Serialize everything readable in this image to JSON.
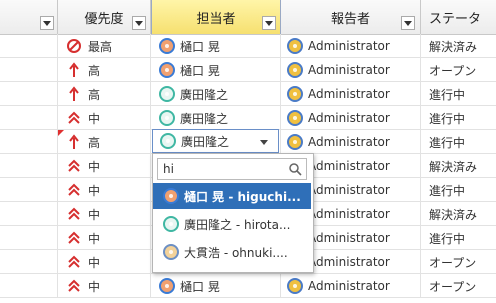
{
  "headers": {
    "priority": "優先度",
    "assignee": "担当者",
    "reporter": "報告者",
    "status": "ステータ"
  },
  "colors": {
    "accent": "#2f6fb8",
    "selectedHeader": "#f6e070",
    "priorityRed": "#e03030"
  },
  "rows": [
    {
      "priority": "最高",
      "pri_icon": "blocker-icon",
      "assignee": "樋口 晃",
      "assignee_icon": "higuchi",
      "reporter": "Administrator",
      "status": "解決済み"
    },
    {
      "priority": "高",
      "pri_icon": "arrow-up-icon",
      "assignee": "樋口 晃",
      "assignee_icon": "higuchi",
      "reporter": "Administrator",
      "status": "オープン"
    },
    {
      "priority": "高",
      "pri_icon": "arrow-up-icon",
      "assignee": "廣田隆之",
      "assignee_icon": "hirota",
      "reporter": "Administrator",
      "status": "進行中"
    },
    {
      "priority": "中",
      "pri_icon": "double-chevron-up-icon",
      "assignee": "廣田隆之",
      "assignee_icon": "hirota",
      "reporter": "Administrator",
      "status": "進行中"
    },
    {
      "priority": "高",
      "pri_icon": "arrow-up-icon",
      "assignee": "廣田隆之",
      "assignee_icon": "hirota",
      "reporter": "Administrator",
      "status": "進行中"
    },
    {
      "priority": "中",
      "pri_icon": "double-chevron-up-icon",
      "assignee": "",
      "assignee_icon": "",
      "reporter": "Administrator",
      "status": "解決済み"
    },
    {
      "priority": "中",
      "pri_icon": "double-chevron-up-icon",
      "assignee": "",
      "assignee_icon": "",
      "reporter": "Administrator",
      "status": "進行中"
    },
    {
      "priority": "中",
      "pri_icon": "double-chevron-up-icon",
      "assignee": "",
      "assignee_icon": "",
      "reporter": "Administrator",
      "status": "解決済み"
    },
    {
      "priority": "中",
      "pri_icon": "double-chevron-up-icon",
      "assignee": "",
      "assignee_icon": "",
      "reporter": "Administrator",
      "status": "進行中"
    },
    {
      "priority": "中",
      "pri_icon": "double-chevron-up-icon",
      "assignee": "",
      "assignee_icon": "",
      "reporter": "Administrator",
      "status": "オープン"
    },
    {
      "priority": "中",
      "pri_icon": "double-chevron-up-icon",
      "assignee": "樋口 晃",
      "assignee_icon": "higuchi",
      "reporter": "Administrator",
      "status": "オープン"
    }
  ],
  "editor": {
    "value": "廣田隆之",
    "search_value": "hi",
    "options": [
      {
        "label": "樋口 晃 - higuchi...",
        "highlighted": true,
        "icon": "higuchi"
      },
      {
        "label": "廣田隆之 - hirota...",
        "highlighted": false,
        "icon": "hirota"
      },
      {
        "label": "大貫浩 - ohnuki....",
        "highlighted": false,
        "icon": "ohnuki"
      }
    ]
  }
}
